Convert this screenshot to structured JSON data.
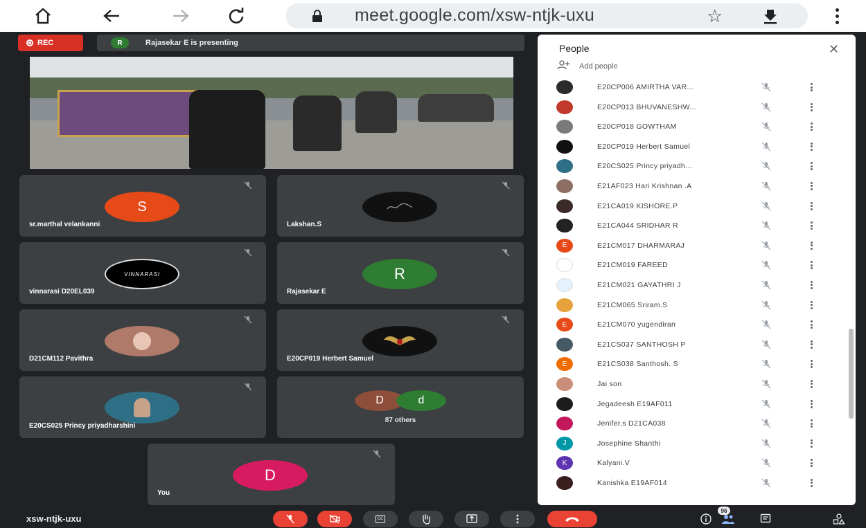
{
  "browser": {
    "url": "meet.google.com/xsw-ntjk-uxu",
    "icons": [
      "home-icon",
      "back-icon",
      "forward-icon",
      "reload-icon",
      "lock-icon",
      "star-icon",
      "download-icon",
      "more-vert-icon"
    ]
  },
  "meeting": {
    "rec_label": "REC",
    "presenter_initial": "R",
    "presenting_text": "Rajasekar E is presenting",
    "code": "xsw-ntjk-uxu"
  },
  "tiles": [
    {
      "name": "sr.marthal velankanni",
      "initial": "S",
      "color": "#e64a19"
    },
    {
      "name": "Lakshan.S",
      "initial": "",
      "color": "#111111"
    },
    {
      "name": "vinnarasi D20EL039",
      "initial": "VINNARASI",
      "color": "#000000"
    },
    {
      "name": "Rajasekar E",
      "initial": "R",
      "color": "#2e7d32"
    },
    {
      "name": "D21CM112 Pavithra",
      "initial": "",
      "color": "#b07a6a"
    },
    {
      "name": "E20CP019 Herbert Samuel",
      "initial": "",
      "color": "#111111"
    },
    {
      "name": "E20CS025 Princy priyadharshini",
      "initial": "",
      "color": "#2f6f86"
    },
    {
      "name": "87 others",
      "initial_a": "D",
      "initial_b": "d",
      "color_a": "#8d4e3b",
      "color_b": "#2e7d32"
    },
    {
      "name": "You",
      "initial": "D",
      "color": "#d81b60"
    }
  ],
  "people": {
    "title": "People",
    "add_label": "Add people",
    "count_badge": "96",
    "list": [
      {
        "name": "E20CP006 AMIRTHA VAR...",
        "color": "#2b2b2b",
        "initial": ""
      },
      {
        "name": "E20CP013 BHUVANESHW...",
        "color": "#c0392b",
        "initial": ""
      },
      {
        "name": "E20CP018 GOWTHAM",
        "color": "#7a7a7a",
        "initial": ""
      },
      {
        "name": "E20CP019 Herbert Samuel",
        "color": "#111111",
        "initial": ""
      },
      {
        "name": "E20CS025 Princy priyadh...",
        "color": "#2f6f86",
        "initial": ""
      },
      {
        "name": "E21AF023 Hari Krishnan .A",
        "color": "#8d6e63",
        "initial": ""
      },
      {
        "name": "E21CA019 KISHORE.P",
        "color": "#3a2a2a",
        "initial": ""
      },
      {
        "name": "E21CA044 SRIDHAR R",
        "color": "#222222",
        "initial": ""
      },
      {
        "name": "E21CM017 DHARMARAJ",
        "color": "#e64a19",
        "initial": "E"
      },
      {
        "name": "E21CM019 FAREED",
        "color": "#ffffff",
        "initial": ""
      },
      {
        "name": "E21CM021 GAYATHRI J",
        "color": "#e3f2fd",
        "initial": ""
      },
      {
        "name": "E21CM065 Sriram.S",
        "color": "#e6a23c",
        "initial": ""
      },
      {
        "name": "E21CM070 yugendiran",
        "color": "#e64a19",
        "initial": "E"
      },
      {
        "name": "E21CS037 SANTHOSH P",
        "color": "#455a64",
        "initial": ""
      },
      {
        "name": "E21CS038 Santhosh. S",
        "color": "#ef6c00",
        "initial": "E"
      },
      {
        "name": "Jai son",
        "color": "#c98f7a",
        "initial": ""
      },
      {
        "name": "Jegadeesh E19AF011",
        "color": "#1c1c1c",
        "initial": ""
      },
      {
        "name": "Jenifer.s D21CA038",
        "color": "#c2185b",
        "initial": ""
      },
      {
        "name": "Josephine Shanthi",
        "color": "#0097a7",
        "initial": "J"
      },
      {
        "name": "Kalyani.V",
        "color": "#5e35b1",
        "initial": "K"
      },
      {
        "name": "Kanishka E19AF014",
        "color": "#3a1f1f",
        "initial": ""
      }
    ]
  },
  "controls": {
    "cc_label": "CC"
  }
}
